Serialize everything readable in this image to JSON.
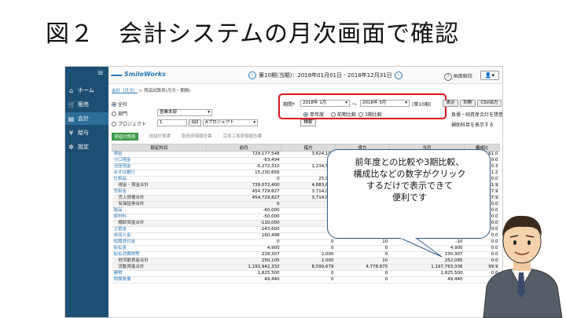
{
  "slide_title": "図２　会計システムの月次画面で確認",
  "sidebar": {
    "menu_icon": "≡",
    "items": [
      {
        "icon": "⌂",
        "label": "ホーム"
      },
      {
        "icon": "🛒",
        "label": "販売"
      },
      {
        "icon": "▤",
        "label": "会計"
      },
      {
        "icon": "¥",
        "label": "給与"
      },
      {
        "icon": "✲",
        "label": "設定"
      }
    ]
  },
  "topbar": {
    "logo": "SmileWorks",
    "period_text": "第10期(当期)：2018年01月01日 - 2018年12月31日",
    "prev": "‹",
    "next": "›",
    "help": "画面解説",
    "help_icon": "?",
    "user_icon": "👤▾"
  },
  "breadcrumb": {
    "link": "会計（月次）",
    "rest": "> 残高試算表(月次・期間)"
  },
  "filters": {
    "all": "全社",
    "dept": "部門",
    "dept_value": "営業本部",
    "project": "プロジェクト",
    "project_code": "1",
    "go": "GO",
    "project_value": "Aプロジェクト",
    "period_label": "期間*",
    "from": "2018年 1月",
    "to": "2018年 3月",
    "tilde": "〜",
    "period_suffix": "(第10期)",
    "opt1": "単年度",
    "opt2": "前期比較",
    "opt3": "3期比較",
    "search": "検索",
    "right_text1": "負債・純資産合計を貸借相殺する",
    "right_text2": "補助科目を表示する",
    "buttons": [
      "表示",
      "印刷",
      "CSV出力"
    ]
  },
  "tabs": [
    "貸借対照表",
    "損益計算書",
    "製造原価報告書",
    "完成工事原価報告書"
  ],
  "table": {
    "headers": [
      "勘定科目",
      "前月",
      "借方",
      "貸方",
      "当月",
      "構成比"
    ],
    "rows": [
      [
        "現金",
        "729,177,548",
        "3,624,100",
        "",
        "",
        "61.0"
      ],
      [
        "小口現金",
        "-63,494",
        "",
        "",
        "",
        "0.0"
      ],
      [
        "当座預金",
        "-5,272,310",
        "1,234,568",
        "",
        "",
        "-0.3"
      ],
      [
        "みずほ銀行",
        "15,230,656",
        "",
        "",
        "",
        "1.2"
      ],
      [
        "仕掛品",
        "0",
        "25,000",
        "",
        "",
        "0.0"
      ],
      [
        "現金・預金合計",
        "739,072,400",
        "4,883,668",
        "",
        "",
        "61.9"
      ],
      [
        "売掛金",
        "454,729,827",
        "3,714,000",
        "",
        "",
        "37.9"
      ],
      [
        "売上債権合計",
        "454,729,827",
        "3,714,000",
        "",
        "",
        "37.9"
      ],
      [
        "有価証券合計",
        "0",
        "",
        "",
        "",
        "0.0"
      ],
      [
        "製品",
        "-60,000",
        "",
        "",
        "",
        "0.0"
      ],
      [
        "原材料",
        "-50,000",
        "",
        "",
        "",
        "0.0"
      ],
      [
        "棚卸資産合計",
        "-110,000",
        "",
        "",
        "",
        "0.0"
      ],
      [
        "立替金",
        "-143,600",
        "0",
        "0",
        "",
        "0.0"
      ],
      [
        "未収入金",
        "160,498",
        "0",
        "0",
        "160,498",
        "0.0"
      ],
      [
        "短期貸付金",
        "0",
        "0",
        "10",
        "-10",
        "0.0"
      ],
      [
        "仮払金",
        "4,900",
        "0",
        "0",
        "4,900",
        "0.0"
      ],
      [
        "仮払消費税等",
        "228,307",
        "2,000",
        "0",
        "230,307",
        "0.0"
      ],
      [
        "他流動資産合計",
        "250,105",
        "2,000",
        "10",
        "252,095",
        "0.0"
      ],
      [
        "流動資産合計",
        "1,193,942,332",
        "8,599,679",
        "4,778,675",
        "1,197,763,336",
        "99.9"
      ],
      [
        "建物",
        "1,825,500",
        "0",
        "0",
        "1,825,500",
        "0.0"
      ],
      [
        "附属設備",
        "49,440",
        "0",
        "0",
        "49,440",
        "0.0"
      ]
    ]
  },
  "callout": {
    "lines": [
      "前年度との比較や3期比較、",
      "構成比などの数字がクリック",
      "するだけで表示できて",
      "便利です"
    ]
  }
}
